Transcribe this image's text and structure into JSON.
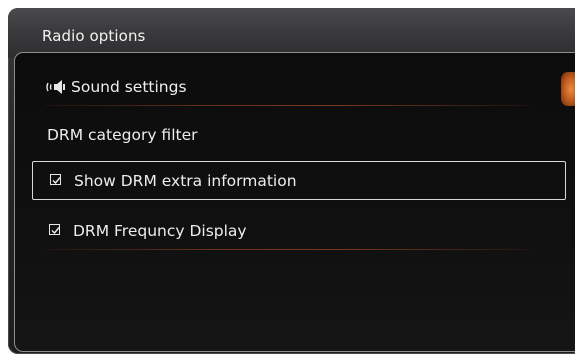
{
  "window": {
    "title": "Radio options"
  },
  "menu": {
    "items": [
      {
        "label": "Sound settings",
        "icon": "speaker-icon"
      },
      {
        "label": "DRM category filter"
      },
      {
        "label": "Show DRM extra information",
        "checked": true,
        "selected": true
      },
      {
        "label": "DRM Frequncy Display",
        "checked": true
      }
    ]
  },
  "colors": {
    "accent": "#e07a30",
    "divider": "#6a3318",
    "text": "#ededed"
  }
}
